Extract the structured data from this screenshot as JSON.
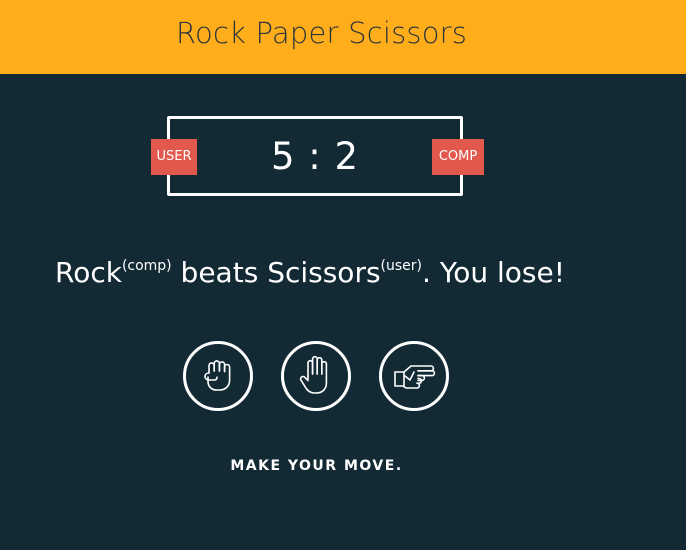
{
  "header": {
    "title": "Rock Paper Scissors"
  },
  "scoreboard": {
    "score": "5 : 2",
    "user_label": "USER",
    "comp_label": "COMP"
  },
  "result": {
    "comp_choice": "Rock",
    "comp_tag": "(comp)",
    "verb": " beats ",
    "user_choice": "Scissors",
    "user_tag": "(user)",
    "outcome": ". You lose!"
  },
  "choices": [
    {
      "name": "rock",
      "icon": "fist-icon"
    },
    {
      "name": "paper",
      "icon": "open-hand-icon"
    },
    {
      "name": "scissors",
      "icon": "scissors-hand-icon"
    }
  ],
  "prompt": "MAKE YOUR MOVE.",
  "colors": {
    "header_bg": "#ffad1a",
    "page_bg": "#132a35",
    "badge_bg": "#e2584d",
    "text": "#ffffff"
  }
}
